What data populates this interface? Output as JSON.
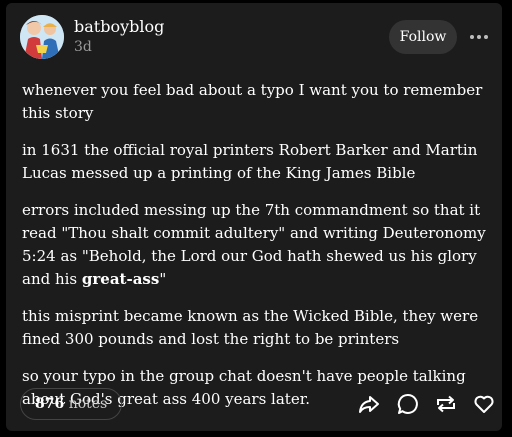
{
  "post": {
    "blog_name": "batboyblog",
    "time": "3d",
    "follow_label": "Follow",
    "more_icon": "more-horizontal-icon",
    "paragraphs": [
      {
        "text": "whenever you feel bad about a typo I want you to remember this story"
      },
      {
        "text": "in 1631 the official royal printers Robert Barker and Martin Lucas messed up a printing of the King James Bible"
      },
      {
        "before": "errors included messing up the 7th commandment so that it read \"Thou shalt commit adultery\" and writing Deuteronomy 5:24 as \"Behold, the Lord our God hath shewed us his glory and his ",
        "bold": "great-ass",
        "after": "\""
      },
      {
        "text": "this misprint became known as the Wicked Bible, they were fined 300 pounds and lost the right to be printers"
      },
      {
        "text": "so your typo in the group chat doesn't have people talking about God's great ass 400 years later."
      }
    ]
  },
  "footer": {
    "notes_count": "876",
    "notes_label": "notes",
    "actions": [
      {
        "icon": "share-icon"
      },
      {
        "icon": "reply-icon"
      },
      {
        "icon": "reblog-icon"
      },
      {
        "icon": "like-icon"
      }
    ]
  },
  "colors": {
    "background": "#000000",
    "card": "#1c1c1c",
    "text": "#ffffff",
    "muted": "#9a9a9a",
    "button": "#333333"
  }
}
